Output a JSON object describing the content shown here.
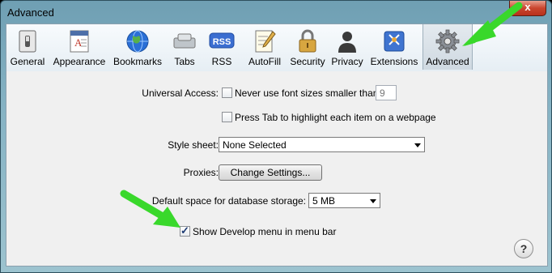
{
  "window": {
    "title": "Advanced",
    "close_label": "x"
  },
  "toolbar": {
    "items": [
      {
        "label": "General",
        "icon": "switch-icon"
      },
      {
        "label": "Appearance",
        "icon": "font-book-icon"
      },
      {
        "label": "Bookmarks",
        "icon": "globe-icon"
      },
      {
        "label": "Tabs",
        "icon": "tabs-icon"
      },
      {
        "label": "RSS",
        "icon": "rss-icon",
        "icon_text": "RSS"
      },
      {
        "label": "AutoFill",
        "icon": "pencil-form-icon"
      },
      {
        "label": "Security",
        "icon": "padlock-icon"
      },
      {
        "label": "Privacy",
        "icon": "silhouette-icon"
      },
      {
        "label": "Extensions",
        "icon": "puzzle-icon"
      },
      {
        "label": "Advanced",
        "icon": "gear-icon",
        "selected": true
      }
    ]
  },
  "advanced": {
    "universal_access": {
      "label": "Universal Access:",
      "min_font": {
        "label": "Never use font sizes smaller than",
        "value": "9",
        "checked": false
      },
      "tab_highlight": {
        "label": "Press Tab to highlight each item on a webpage",
        "checked": false
      }
    },
    "style_sheet": {
      "label": "Style sheet:",
      "value": "None Selected"
    },
    "proxies": {
      "label": "Proxies:",
      "button": "Change Settings..."
    },
    "db_storage": {
      "label": "Default space for database storage:",
      "value": "5 MB"
    },
    "develop_menu": {
      "label": "Show Develop menu in menu bar",
      "checked": true
    },
    "help_label": "?"
  },
  "annotations": {
    "arrow_color": "#39d82b"
  }
}
